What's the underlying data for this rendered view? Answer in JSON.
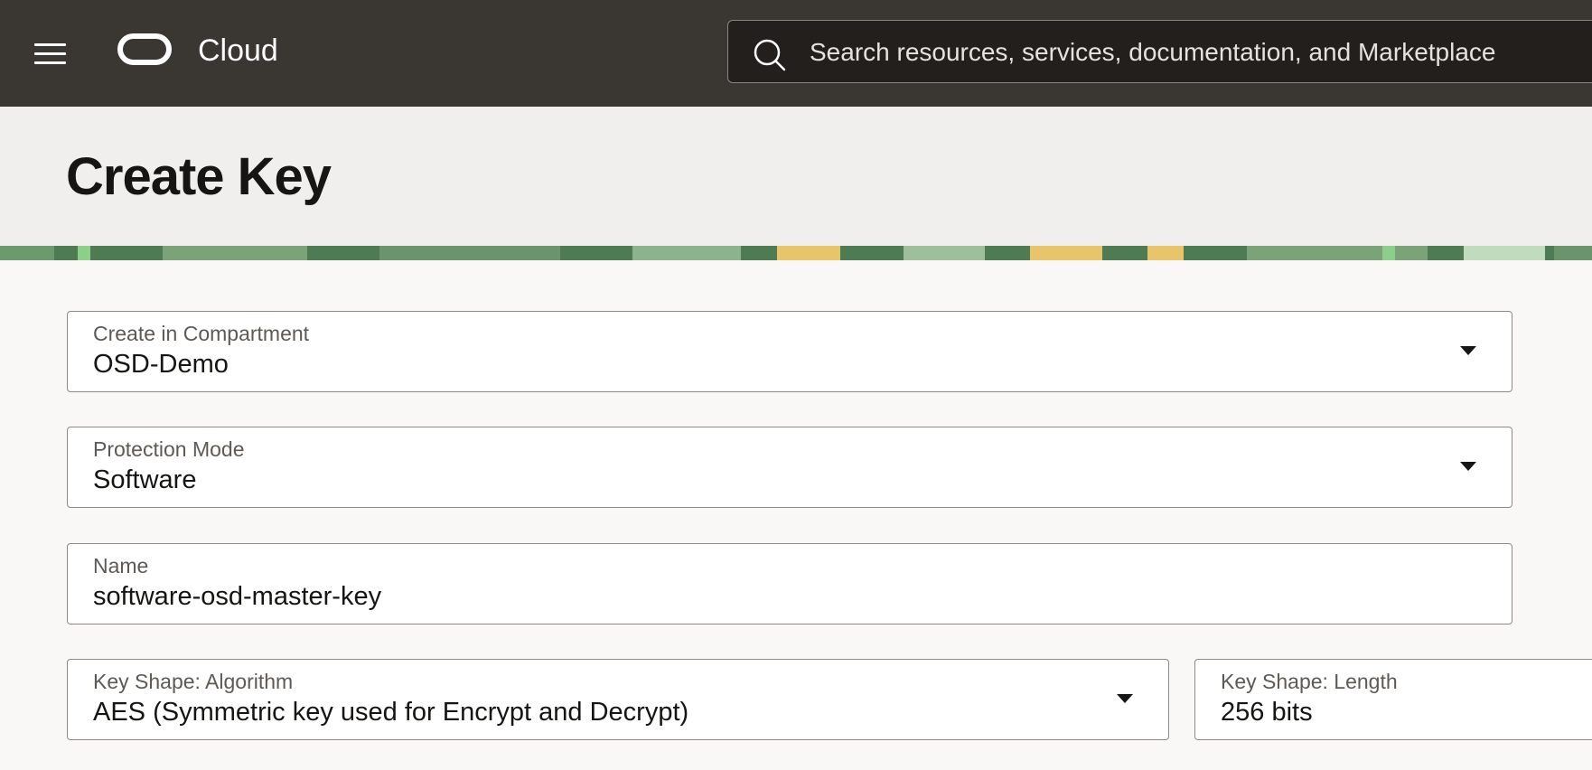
{
  "topbar": {
    "brand": "Cloud",
    "menu_icon": "hamburger-menu-icon",
    "logo_icon": "oracle-logo-icon",
    "search": {
      "icon": "search-icon",
      "placeholder": "Search resources, services, documentation, and Marketplace"
    }
  },
  "page": {
    "title": "Create Key"
  },
  "form": {
    "compartment": {
      "label": "Create in Compartment",
      "value": "OSD-Demo"
    },
    "protection_mode": {
      "label": "Protection Mode",
      "value": "Software"
    },
    "name": {
      "label": "Name",
      "value": "software-osd-master-key"
    },
    "algorithm": {
      "label": "Key Shape: Algorithm",
      "value": "AES (Symmetric key used for Encrypt and Decrypt)"
    },
    "length": {
      "label": "Key Shape: Length",
      "value": "256 bits"
    }
  },
  "colors": {
    "topbar_bg": "#3a3632",
    "header_bg": "#f0efed",
    "body_bg": "#f9f8f6",
    "decor_green": "#5a8a5c",
    "decor_yellow": "#e8c46a"
  }
}
